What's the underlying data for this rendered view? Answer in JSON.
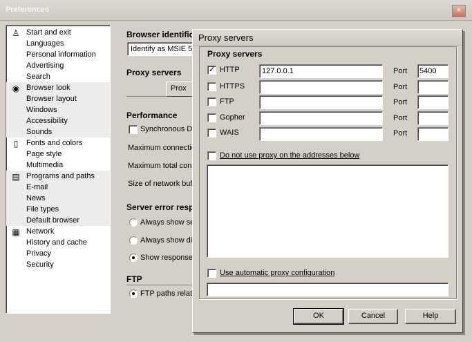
{
  "window": {
    "title": "Preferences",
    "close": "×"
  },
  "sidebar": {
    "groups": [
      {
        "icon": "person-icon",
        "glyph": "♙",
        "items": [
          "Start and exit",
          "Languages",
          "Personal information",
          "Advertising",
          "Search"
        ]
      },
      {
        "icon": "eye-icon",
        "glyph": "◉",
        "items": [
          "Browser look",
          "Browser layout",
          "Windows",
          "Accessibility",
          "Sounds"
        ]
      },
      {
        "icon": "document-icon",
        "glyph": "▯",
        "items": [
          "Fonts and colors",
          "Page style",
          "Multimedia"
        ]
      },
      {
        "icon": "programs-icon",
        "glyph": "▤",
        "items": [
          "Programs and paths",
          "E-mail",
          "News",
          "File types",
          "Default browser"
        ]
      },
      {
        "icon": "network-icon",
        "glyph": "▦",
        "items": [
          "Network",
          "History and cache",
          "Privacy",
          "Security"
        ]
      }
    ]
  },
  "main": {
    "browser_identification": {
      "heading": "Browser identifica",
      "value": "Identify as MSIE 5"
    },
    "proxy": {
      "heading": "Proxy servers",
      "button": "Prox"
    },
    "performance": {
      "heading": "Performance",
      "synchronous": "Synchronous DN",
      "max_connections": "Maximum connectio",
      "max_total": "Maximum total conn",
      "network_buffer": "Size of network buff"
    },
    "server_error": {
      "heading": "Server error respo",
      "always_show_server": "Always show ser",
      "always_show_dialog": "Always show dia",
      "show_response": "Show response"
    },
    "ftp": {
      "heading": "FTP",
      "paths": "FTP paths relati"
    }
  },
  "dialog": {
    "title": "Proxy servers",
    "group_label": "Proxy servers",
    "port_label": "Port",
    "protocols": [
      {
        "name": "HTTP",
        "checked": true,
        "server": "127.0.0.1",
        "port": "5400"
      },
      {
        "name": "HTTPS",
        "checked": false,
        "server": "",
        "port": ""
      },
      {
        "name": "FTP",
        "checked": false,
        "server": "",
        "port": ""
      },
      {
        "name": "Gopher",
        "checked": false,
        "server": "",
        "port": ""
      },
      {
        "name": "WAIS",
        "checked": false,
        "server": "",
        "port": ""
      }
    ],
    "no_proxy_label": "Do not use proxy on the addresses below",
    "no_proxy_list": "",
    "auto_config_label": "Use automatic proxy configuration",
    "auto_config_url": "",
    "buttons": {
      "ok": "OK",
      "cancel": "Cancel",
      "help": "Help"
    },
    "checkmark": "✓"
  }
}
